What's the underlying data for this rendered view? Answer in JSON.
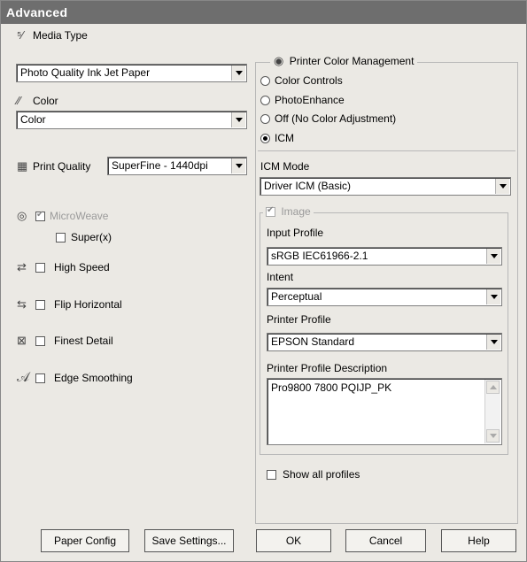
{
  "title": "Advanced",
  "left": {
    "media_type_label": "Media Type",
    "media_type_value": "Photo Quality Ink Jet Paper",
    "color_label": "Color",
    "color_value": "Color",
    "print_quality_label": "Print Quality",
    "print_quality_value": "SuperFine - 1440dpi",
    "microweave_label": "MicroWeave",
    "super_label": "Super(x)",
    "high_speed_label": "High Speed",
    "flip_horizontal_label": "Flip Horizontal",
    "finest_detail_label": "Finest Detail",
    "edge_smoothing_label": "Edge Smoothing"
  },
  "right": {
    "group_title": "Printer Color Management",
    "radio_options": [
      "Color Controls",
      "PhotoEnhance",
      "Off (No Color Adjustment)",
      "ICM"
    ],
    "selected_option": "ICM",
    "icm_mode_label": "ICM Mode",
    "icm_mode_value": "Driver ICM (Basic)",
    "image_group_title": "Image",
    "input_profile_label": "Input Profile",
    "input_profile_value": "sRGB IEC61966-2.1",
    "intent_label": "Intent",
    "intent_value": "Perceptual",
    "printer_profile_label": "Printer Profile",
    "printer_profile_value": "EPSON Standard",
    "profile_description_label": "Printer Profile Description",
    "profile_description_value": "Pro9800 7800 PQIJP_PK",
    "show_all_profiles_label": "Show all profiles"
  },
  "buttons": {
    "paper_config": "Paper Config",
    "save_settings": "Save Settings...",
    "ok": "OK",
    "cancel": "Cancel",
    "help": "Help"
  }
}
